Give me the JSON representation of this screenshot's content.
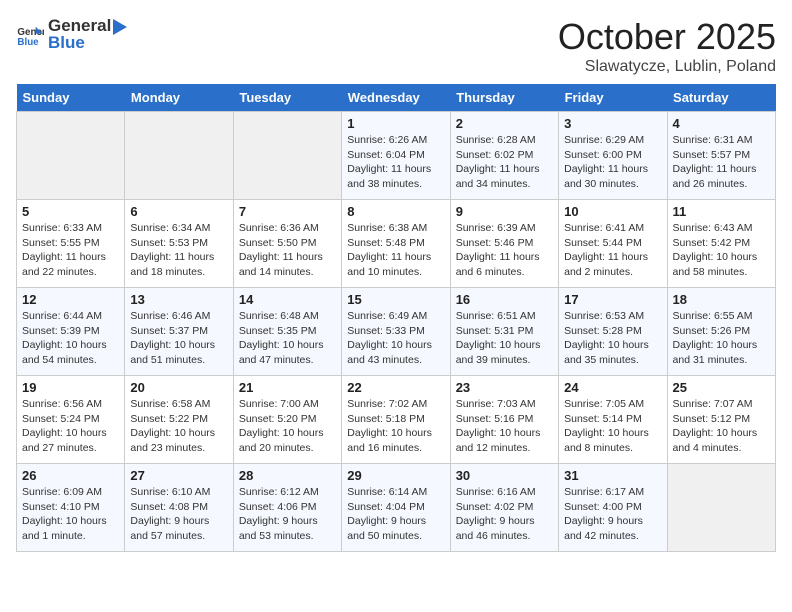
{
  "header": {
    "logo_general": "General",
    "logo_blue": "Blue",
    "month": "October 2025",
    "location": "Slawatycze, Lublin, Poland"
  },
  "weekdays": [
    "Sunday",
    "Monday",
    "Tuesday",
    "Wednesday",
    "Thursday",
    "Friday",
    "Saturday"
  ],
  "weeks": [
    [
      {
        "day": "",
        "sunrise": "",
        "sunset": "",
        "daylight": ""
      },
      {
        "day": "",
        "sunrise": "",
        "sunset": "",
        "daylight": ""
      },
      {
        "day": "",
        "sunrise": "",
        "sunset": "",
        "daylight": ""
      },
      {
        "day": "1",
        "sunrise": "Sunrise: 6:26 AM",
        "sunset": "Sunset: 6:04 PM",
        "daylight": "Daylight: 11 hours and 38 minutes."
      },
      {
        "day": "2",
        "sunrise": "Sunrise: 6:28 AM",
        "sunset": "Sunset: 6:02 PM",
        "daylight": "Daylight: 11 hours and 34 minutes."
      },
      {
        "day": "3",
        "sunrise": "Sunrise: 6:29 AM",
        "sunset": "Sunset: 6:00 PM",
        "daylight": "Daylight: 11 hours and 30 minutes."
      },
      {
        "day": "4",
        "sunrise": "Sunrise: 6:31 AM",
        "sunset": "Sunset: 5:57 PM",
        "daylight": "Daylight: 11 hours and 26 minutes."
      }
    ],
    [
      {
        "day": "5",
        "sunrise": "Sunrise: 6:33 AM",
        "sunset": "Sunset: 5:55 PM",
        "daylight": "Daylight: 11 hours and 22 minutes."
      },
      {
        "day": "6",
        "sunrise": "Sunrise: 6:34 AM",
        "sunset": "Sunset: 5:53 PM",
        "daylight": "Daylight: 11 hours and 18 minutes."
      },
      {
        "day": "7",
        "sunrise": "Sunrise: 6:36 AM",
        "sunset": "Sunset: 5:50 PM",
        "daylight": "Daylight: 11 hours and 14 minutes."
      },
      {
        "day": "8",
        "sunrise": "Sunrise: 6:38 AM",
        "sunset": "Sunset: 5:48 PM",
        "daylight": "Daylight: 11 hours and 10 minutes."
      },
      {
        "day": "9",
        "sunrise": "Sunrise: 6:39 AM",
        "sunset": "Sunset: 5:46 PM",
        "daylight": "Daylight: 11 hours and 6 minutes."
      },
      {
        "day": "10",
        "sunrise": "Sunrise: 6:41 AM",
        "sunset": "Sunset: 5:44 PM",
        "daylight": "Daylight: 11 hours and 2 minutes."
      },
      {
        "day": "11",
        "sunrise": "Sunrise: 6:43 AM",
        "sunset": "Sunset: 5:42 PM",
        "daylight": "Daylight: 10 hours and 58 minutes."
      }
    ],
    [
      {
        "day": "12",
        "sunrise": "Sunrise: 6:44 AM",
        "sunset": "Sunset: 5:39 PM",
        "daylight": "Daylight: 10 hours and 54 minutes."
      },
      {
        "day": "13",
        "sunrise": "Sunrise: 6:46 AM",
        "sunset": "Sunset: 5:37 PM",
        "daylight": "Daylight: 10 hours and 51 minutes."
      },
      {
        "day": "14",
        "sunrise": "Sunrise: 6:48 AM",
        "sunset": "Sunset: 5:35 PM",
        "daylight": "Daylight: 10 hours and 47 minutes."
      },
      {
        "day": "15",
        "sunrise": "Sunrise: 6:49 AM",
        "sunset": "Sunset: 5:33 PM",
        "daylight": "Daylight: 10 hours and 43 minutes."
      },
      {
        "day": "16",
        "sunrise": "Sunrise: 6:51 AM",
        "sunset": "Sunset: 5:31 PM",
        "daylight": "Daylight: 10 hours and 39 minutes."
      },
      {
        "day": "17",
        "sunrise": "Sunrise: 6:53 AM",
        "sunset": "Sunset: 5:28 PM",
        "daylight": "Daylight: 10 hours and 35 minutes."
      },
      {
        "day": "18",
        "sunrise": "Sunrise: 6:55 AM",
        "sunset": "Sunset: 5:26 PM",
        "daylight": "Daylight: 10 hours and 31 minutes."
      }
    ],
    [
      {
        "day": "19",
        "sunrise": "Sunrise: 6:56 AM",
        "sunset": "Sunset: 5:24 PM",
        "daylight": "Daylight: 10 hours and 27 minutes."
      },
      {
        "day": "20",
        "sunrise": "Sunrise: 6:58 AM",
        "sunset": "Sunset: 5:22 PM",
        "daylight": "Daylight: 10 hours and 23 minutes."
      },
      {
        "day": "21",
        "sunrise": "Sunrise: 7:00 AM",
        "sunset": "Sunset: 5:20 PM",
        "daylight": "Daylight: 10 hours and 20 minutes."
      },
      {
        "day": "22",
        "sunrise": "Sunrise: 7:02 AM",
        "sunset": "Sunset: 5:18 PM",
        "daylight": "Daylight: 10 hours and 16 minutes."
      },
      {
        "day": "23",
        "sunrise": "Sunrise: 7:03 AM",
        "sunset": "Sunset: 5:16 PM",
        "daylight": "Daylight: 10 hours and 12 minutes."
      },
      {
        "day": "24",
        "sunrise": "Sunrise: 7:05 AM",
        "sunset": "Sunset: 5:14 PM",
        "daylight": "Daylight: 10 hours and 8 minutes."
      },
      {
        "day": "25",
        "sunrise": "Sunrise: 7:07 AM",
        "sunset": "Sunset: 5:12 PM",
        "daylight": "Daylight: 10 hours and 4 minutes."
      }
    ],
    [
      {
        "day": "26",
        "sunrise": "Sunrise: 6:09 AM",
        "sunset": "Sunset: 4:10 PM",
        "daylight": "Daylight: 10 hours and 1 minute."
      },
      {
        "day": "27",
        "sunrise": "Sunrise: 6:10 AM",
        "sunset": "Sunset: 4:08 PM",
        "daylight": "Daylight: 9 hours and 57 minutes."
      },
      {
        "day": "28",
        "sunrise": "Sunrise: 6:12 AM",
        "sunset": "Sunset: 4:06 PM",
        "daylight": "Daylight: 9 hours and 53 minutes."
      },
      {
        "day": "29",
        "sunrise": "Sunrise: 6:14 AM",
        "sunset": "Sunset: 4:04 PM",
        "daylight": "Daylight: 9 hours and 50 minutes."
      },
      {
        "day": "30",
        "sunrise": "Sunrise: 6:16 AM",
        "sunset": "Sunset: 4:02 PM",
        "daylight": "Daylight: 9 hours and 46 minutes."
      },
      {
        "day": "31",
        "sunrise": "Sunrise: 6:17 AM",
        "sunset": "Sunset: 4:00 PM",
        "daylight": "Daylight: 9 hours and 42 minutes."
      },
      {
        "day": "",
        "sunrise": "",
        "sunset": "",
        "daylight": ""
      }
    ]
  ]
}
